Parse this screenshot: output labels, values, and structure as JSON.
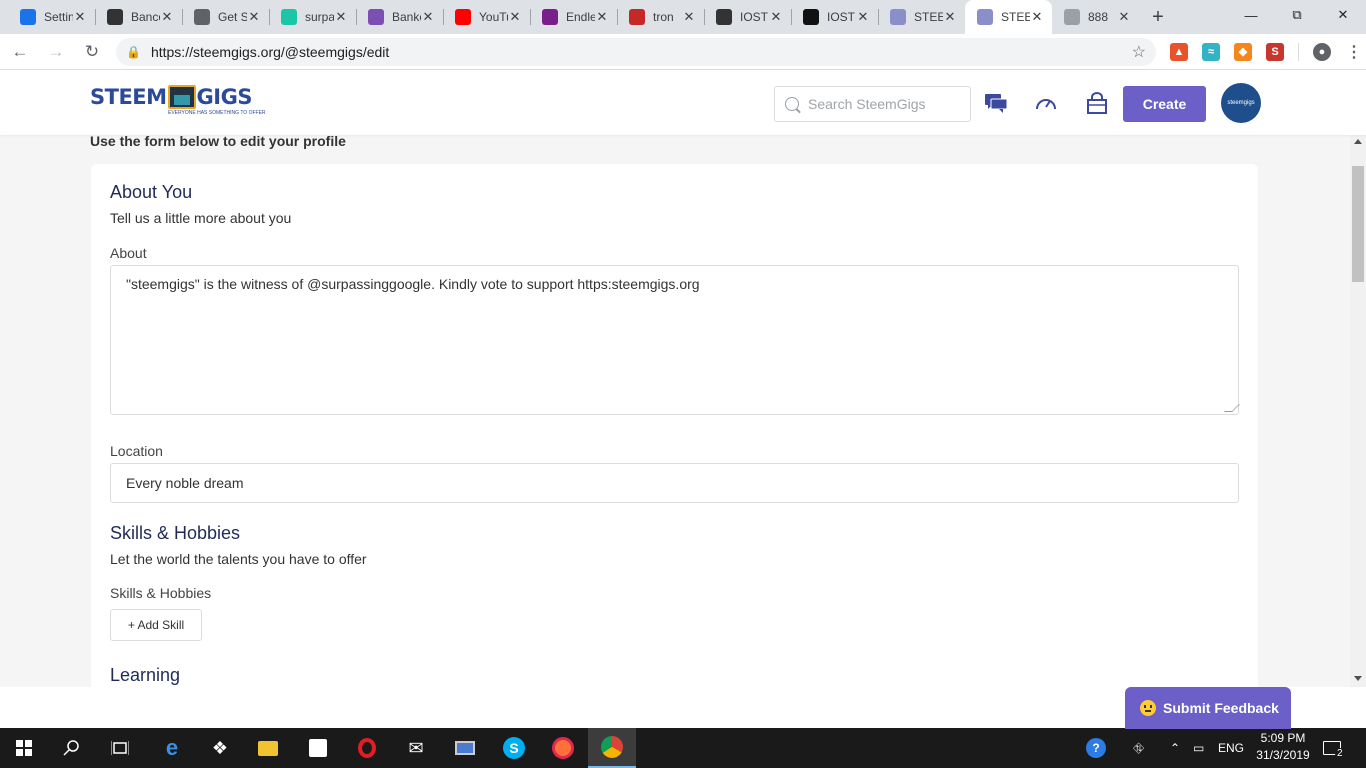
{
  "browser": {
    "tabs": [
      {
        "title": "Settings",
        "icon": "gear-icon",
        "color": "#1a73e8"
      },
      {
        "title": "Bancor",
        "icon": "bancor-icon",
        "color": "#333333"
      },
      {
        "title": "Get Steem",
        "icon": "page-icon",
        "color": "#5f6368"
      },
      {
        "title": "surpassing",
        "icon": "circle-icon",
        "color": "#1bc6a6"
      },
      {
        "title": "Bankera",
        "icon": "b-icon",
        "color": "#7b4fb4"
      },
      {
        "title": "YouTube",
        "icon": "youtube-icon",
        "color": "#ff0000"
      },
      {
        "title": "Endless",
        "icon": "hex-icon",
        "color": "#7a1f8a"
      },
      {
        "title": "tron",
        "icon": "flag-icon",
        "color": "#c62828"
      },
      {
        "title": "IOST",
        "icon": "iost-icon",
        "color": "#333333"
      },
      {
        "title": "IOST",
        "icon": "s-icon",
        "color": "#111111"
      },
      {
        "title": "STEEM",
        "icon": "steem-icon",
        "color": "#8a8fc9"
      },
      {
        "title": "STEEM",
        "icon": "steem-icon",
        "color": "#8a8fc9"
      },
      {
        "title": "888",
        "icon": "loading-icon",
        "color": "#9aa0a6"
      }
    ],
    "active_tab": 11,
    "url": "https://steemgigs.org/@steemgigs/edit"
  },
  "header": {
    "logo_left": "STEEM",
    "logo_right": "GIGS",
    "logo_tagline": "EVERYONE HAS SOMETHING TO OFFER",
    "search_placeholder": "Search SteemGigs",
    "create_label": "Create",
    "avatar_text": "steemgigs"
  },
  "page": {
    "intro": "Use the form below to edit your profile",
    "about_you": {
      "title": "About You",
      "subtitle": "Tell us a little more about you",
      "about_label": "About",
      "about_value": "\"steemgigs\" is the witness of @surpassinggoogle. Kindly vote to support https:steemgigs.org",
      "location_label": "Location",
      "location_value": "Every noble dream"
    },
    "skills": {
      "title": "Skills & Hobbies",
      "subtitle": "Let the world the talents you have to offer",
      "label": "Skills & Hobbies",
      "add_label": "+ Add Skill"
    },
    "learning": {
      "title": "Learning"
    }
  },
  "feedback": {
    "label": "Submit Feedback"
  },
  "taskbar": {
    "lang": "ENG",
    "time": "5:09 PM",
    "date": "31/3/2019",
    "notifications": "2"
  },
  "colors": {
    "accent": "#6c5fc7",
    "heading": "#1f2a5a",
    "logo": "#2b4a9a"
  }
}
